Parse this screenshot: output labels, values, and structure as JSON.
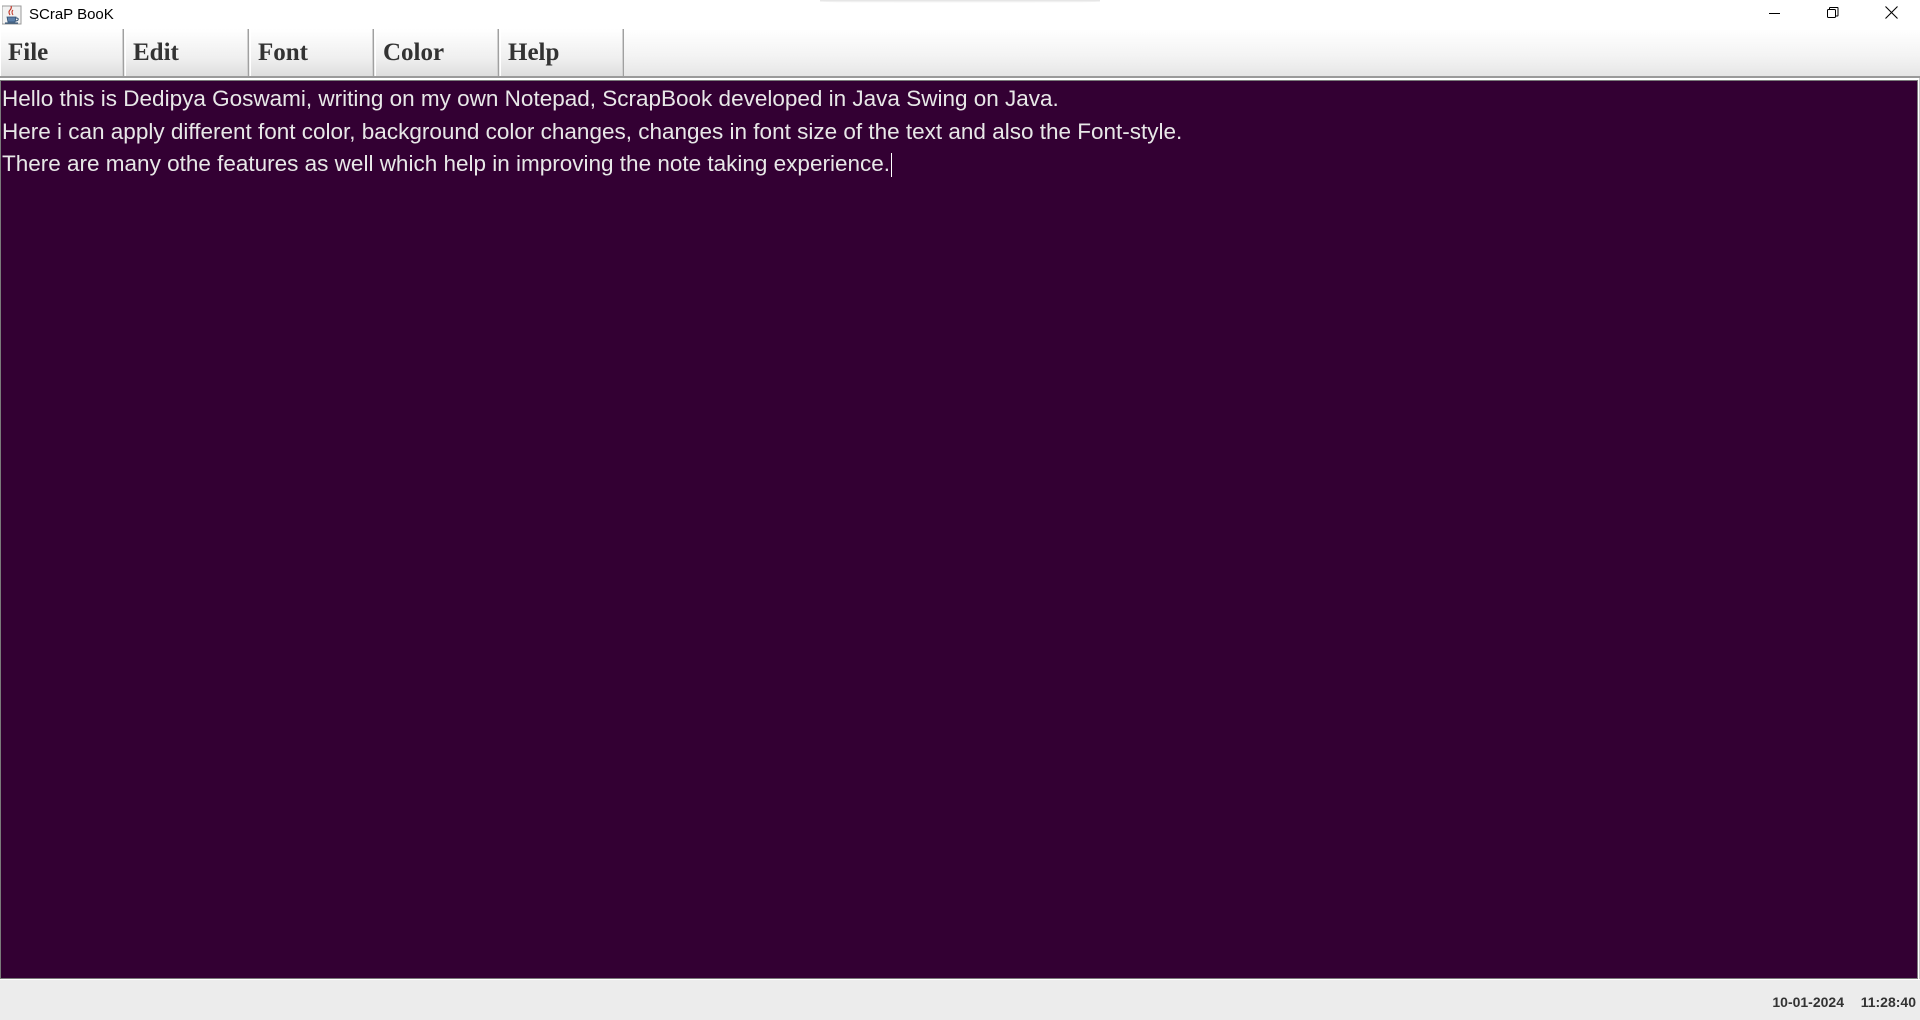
{
  "window": {
    "title": "SCraP BooK",
    "icon": "java-cup-icon"
  },
  "window_controls": {
    "minimize_icon": "minimize-icon",
    "restore_icon": "restore-icon",
    "close_icon": "close-icon"
  },
  "menu": {
    "items": [
      {
        "label": "File"
      },
      {
        "label": "Edit"
      },
      {
        "label": "Font"
      },
      {
        "label": "Color"
      },
      {
        "label": "Help"
      }
    ]
  },
  "editor": {
    "background_color": "#330033",
    "text_color": "#e8e8e8",
    "lines": [
      "Hello this is Dedipya Goswami, writing on my own Notepad, ScrapBook developed in Java Swing on Java.",
      "Here i can apply different font color, background color changes, changes in font size of the text and also the Font-style.",
      "There are many othe features as well which help in improving the note taking experience."
    ]
  },
  "status": {
    "date": "10-01-2024",
    "time": "11:28:40"
  }
}
